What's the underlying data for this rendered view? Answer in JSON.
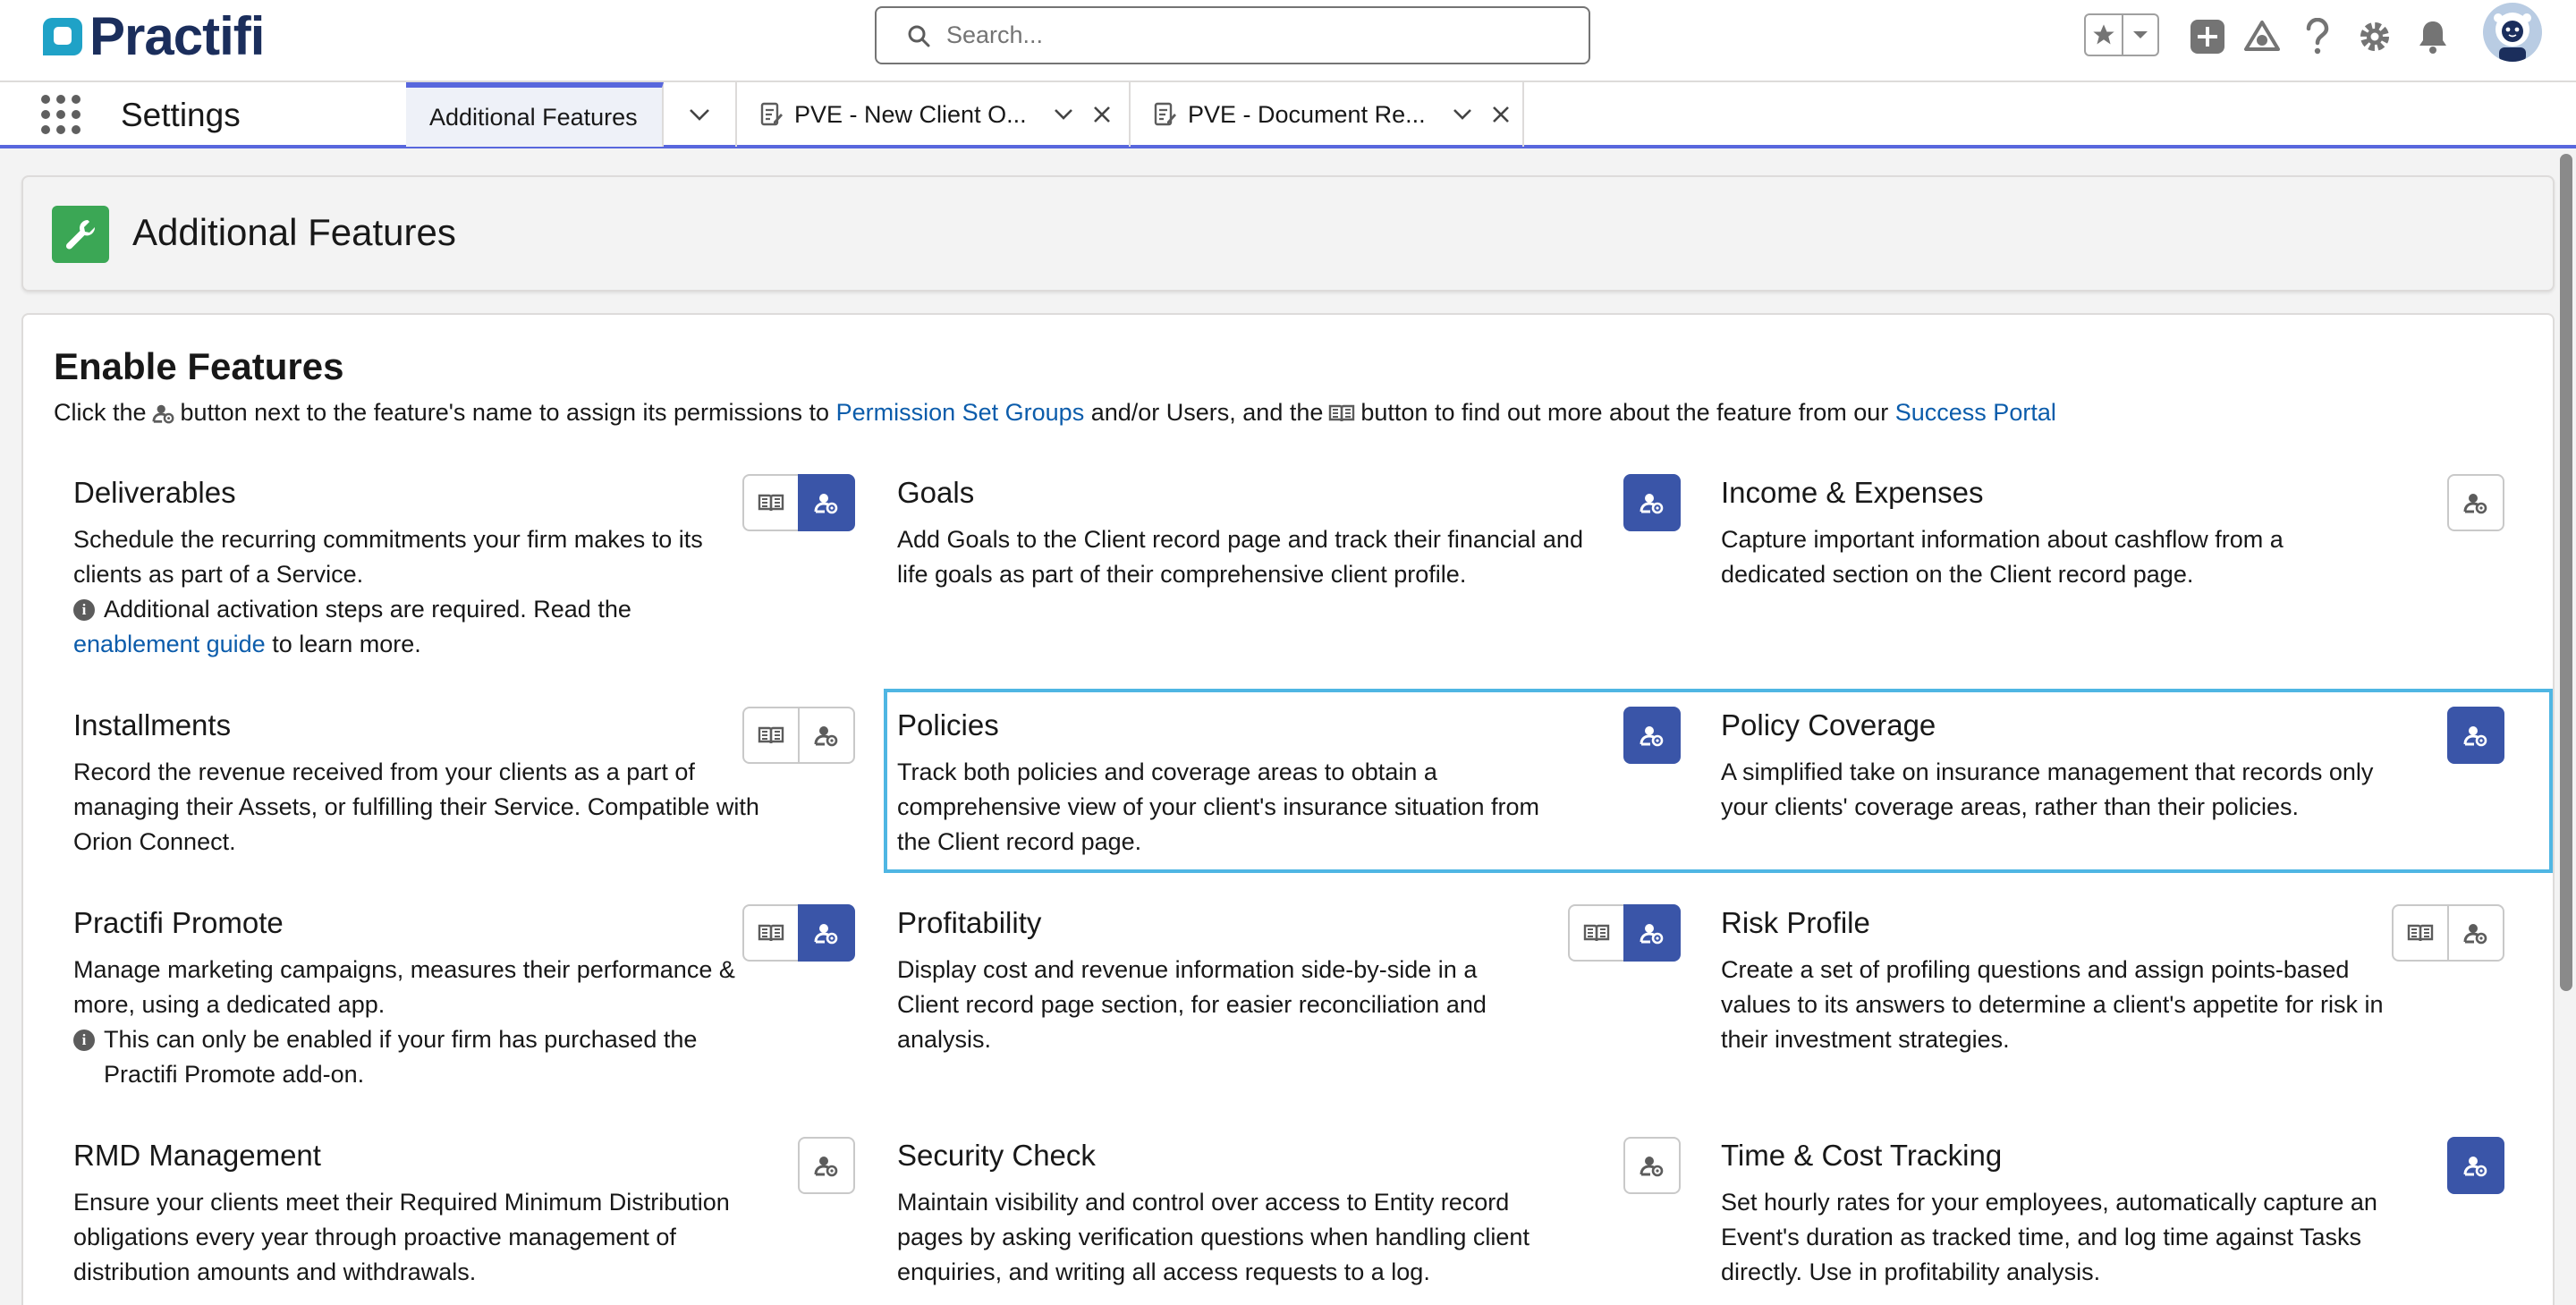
{
  "header": {
    "logo_text": "Practifi",
    "search_placeholder": "Search...",
    "icons": [
      "favorites-star-icon",
      "favorites-dropdown-icon",
      "global-actions-plus-icon",
      "trailhead-icon",
      "help-icon",
      "setup-gear-icon",
      "notifications-bell-icon",
      "user-avatar"
    ]
  },
  "nav": {
    "app_name": "Settings",
    "tabs": [
      {
        "label": "Additional Features",
        "active": true
      },
      {
        "label": "PVE - New Client O...",
        "active": false
      },
      {
        "label": "PVE - Document Re...",
        "active": false
      }
    ]
  },
  "page_header": {
    "title": "Additional Features",
    "icon": "wrench-icon"
  },
  "main": {
    "title": "Enable Features",
    "intro": {
      "part1": "Click the",
      "part2": "button next to the feature's name to assign its permissions to",
      "link1": "Permission Set Groups",
      "part3": "and/or Users, and the",
      "part4": "button to find out more about the feature from our",
      "link2": "Success Portal"
    },
    "features": [
      {
        "title": "Deliverables",
        "desc": "Schedule the recurring commitments your firm makes to its clients as part of a Service.",
        "note_pre": "Additional activation steps are required. Read the",
        "note_link": "enablement guide",
        "note_post": "to learn more.",
        "has_book": true,
        "enabled": true
      },
      {
        "title": "Goals",
        "desc": "Add Goals to the Client record page and track their financial and life goals as part of their comprehensive client profile.",
        "has_book": false,
        "enabled": true
      },
      {
        "title": "Income & Expenses",
        "desc": "Capture important information about cashflow from a dedicated section on the Client record page.",
        "has_book": false,
        "enabled": false
      },
      {
        "title": "Installments",
        "desc": "Record the revenue received from your clients as a part of managing their Assets, or fulfilling their Service. Compatible with Orion Connect.",
        "has_book": true,
        "enabled": false
      },
      {
        "title": "Policies",
        "desc": "Track both policies and coverage areas to obtain a comprehensive view of your client's insurance situation from the Client record page.",
        "has_book": false,
        "enabled": true
      },
      {
        "title": "Policy Coverage",
        "desc": "A simplified take on insurance management that records only your clients' coverage areas, rather than their policies.",
        "has_book": false,
        "enabled": true
      },
      {
        "title": "Practifi Promote",
        "desc": "Manage marketing campaigns, measures their performance & more, using a dedicated app.",
        "note_pre": "This can only be enabled if your firm has purchased the Practifi Promote add-on.",
        "has_book": true,
        "enabled": true
      },
      {
        "title": "Profitability",
        "desc": "Display cost and revenue information side-by-side in a Client record page section, for easier reconciliation and analysis.",
        "has_book": true,
        "enabled": true
      },
      {
        "title": "Risk Profile",
        "desc": "Create a set of profiling questions and assign points-based values to its answers to determine a client's appetite for risk in their investment strategies.",
        "has_book": true,
        "enabled": false
      },
      {
        "title": "RMD Management",
        "desc": "Ensure your clients meet their Required Minimum Distribution obligations every year through proactive management of distribution amounts and withdrawals.",
        "has_book": false,
        "enabled": false
      },
      {
        "title": "Security Check",
        "desc": "Maintain visibility and control over access to Entity record pages by asking verification questions when handling client enquiries, and writing all access requests to a log.",
        "has_book": false,
        "enabled": false
      },
      {
        "title": "Time & Cost Tracking",
        "desc": "Set hourly rates for your employees, automatically capture an Event's duration as tracked time, and log time against Tasks directly. Use in profitability analysis.",
        "has_book": false,
        "enabled": true
      }
    ]
  },
  "colors": {
    "brand_navy": "#1b2e5c",
    "brand_teal": "#1fa2c7",
    "button_filled": "#3a55a8",
    "link": "#0b5cab",
    "highlight": "#4fb6e3",
    "nav_accent": "#5867dd",
    "header_icon_green": "#3ba755"
  }
}
